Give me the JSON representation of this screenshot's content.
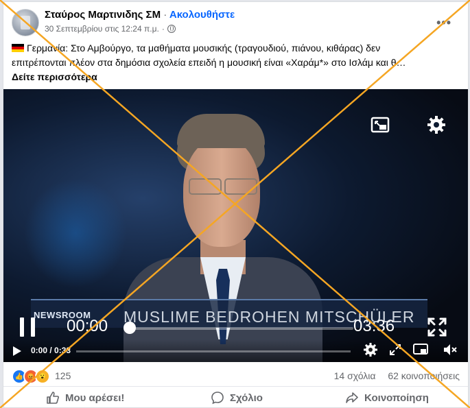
{
  "post": {
    "author": "Σταύρος Μαρτινιδης ΣΜ",
    "separator": "·",
    "follow_label": "Ακολουθήστε",
    "timestamp": "30 Σεπτεμβρίου στις 12:24 π.μ.",
    "timestamp_separator": "·",
    "more_label": "•••",
    "caption_line1": "Γερμανία: Στο Αμβούργο, τα μαθήματα μουσικής (τραγουδιού, πιάνου, κιθάρας) δεν",
    "caption_line2": "επιτρέπονται πλέον στα δημόσια σχολεία επειδή η μουσική είναι «Χαράμ*» στο Ισλάμ και θ…",
    "see_more": "Δείτε περισσότερα"
  },
  "video": {
    "channel_label": "NEWSROOM",
    "headline": "MUSLIME BEDROHEN MITSCHÜLER",
    "current_time_large": "00:00",
    "duration_large": "03:36",
    "time_small": "0:00 / 0:33",
    "progress": 0.0
  },
  "stats": {
    "reaction_count": "125",
    "comments": "14 σχόλια",
    "shares": "62 κοινοποιήσεις"
  },
  "actions": {
    "like": "Μου αρέσει!",
    "comment": "Σχόλιο",
    "share": "Κοινοποίηση"
  },
  "overlay": {
    "cross_color": "#f5a623"
  }
}
